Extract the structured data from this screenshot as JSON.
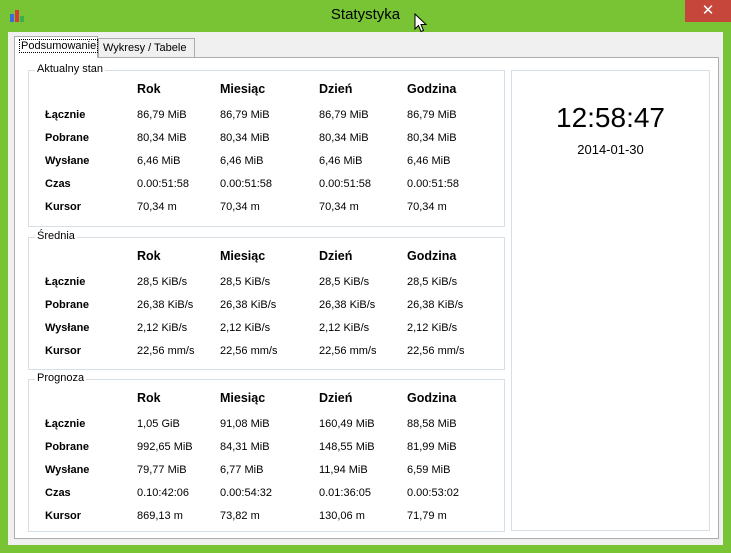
{
  "window": {
    "title": "Statystyka",
    "close_glyph": "✕"
  },
  "tabs": [
    {
      "label": "Podsumowanie",
      "active": true
    },
    {
      "label": "Wykresy / Tabele",
      "active": false
    }
  ],
  "columns": [
    "Rok",
    "Miesiąc",
    "Dzień",
    "Godzina"
  ],
  "groups": [
    {
      "legend": "Aktualny stan",
      "rows": [
        {
          "label": "Łącznie",
          "values": [
            "86,79 MiB",
            "86,79 MiB",
            "86,79 MiB",
            "86,79 MiB"
          ]
        },
        {
          "label": "Pobrane",
          "values": [
            "80,34 MiB",
            "80,34 MiB",
            "80,34 MiB",
            "80,34 MiB"
          ]
        },
        {
          "label": "Wysłane",
          "values": [
            "6,46 MiB",
            "6,46 MiB",
            "6,46 MiB",
            "6,46 MiB"
          ]
        },
        {
          "label": "Czas",
          "values": [
            "0.00:51:58",
            "0.00:51:58",
            "0.00:51:58",
            "0.00:51:58"
          ]
        },
        {
          "label": "Kursor",
          "values": [
            "70,34 m",
            "70,34 m",
            "70,34 m",
            "70,34 m"
          ]
        }
      ]
    },
    {
      "legend": "Średnia",
      "rows": [
        {
          "label": "Łącznie",
          "values": [
            "28,5 KiB/s",
            "28,5 KiB/s",
            "28,5 KiB/s",
            "28,5 KiB/s"
          ]
        },
        {
          "label": "Pobrane",
          "values": [
            "26,38 KiB/s",
            "26,38 KiB/s",
            "26,38 KiB/s",
            "26,38 KiB/s"
          ]
        },
        {
          "label": "Wysłane",
          "values": [
            "2,12 KiB/s",
            "2,12 KiB/s",
            "2,12 KiB/s",
            "2,12 KiB/s"
          ]
        },
        {
          "label": "Kursor",
          "values": [
            "22,56 mm/s",
            "22,56 mm/s",
            "22,56 mm/s",
            "22,56 mm/s"
          ]
        }
      ]
    },
    {
      "legend": "Prognoza",
      "rows": [
        {
          "label": "Łącznie",
          "values": [
            "1,05 GiB",
            "91,08 MiB",
            "160,49 MiB",
            "88,58 MiB"
          ]
        },
        {
          "label": "Pobrane",
          "values": [
            "992,65 MiB",
            "84,31 MiB",
            "148,55 MiB",
            "81,99 MiB"
          ]
        },
        {
          "label": "Wysłane",
          "values": [
            "79,77 MiB",
            "6,77 MiB",
            "11,94 MiB",
            "6,59 MiB"
          ]
        },
        {
          "label": "Czas",
          "values": [
            "0.10:42:06",
            "0.00:54:32",
            "0.01:36:05",
            "0.00:53:02"
          ]
        },
        {
          "label": "Kursor",
          "values": [
            "869,13 m",
            "73,82 m",
            "130,06 m",
            "71,79 m"
          ]
        }
      ]
    }
  ],
  "clock": {
    "time": "12:58:47",
    "date": "2014-01-30"
  },
  "icons": {
    "app": "bar-chart-icon",
    "close": "close-icon",
    "cursor": "mouse-pointer-icon"
  },
  "colors": {
    "frame": "#78c434",
    "close": "#c7463c",
    "panel": "#f0f0f0"
  }
}
